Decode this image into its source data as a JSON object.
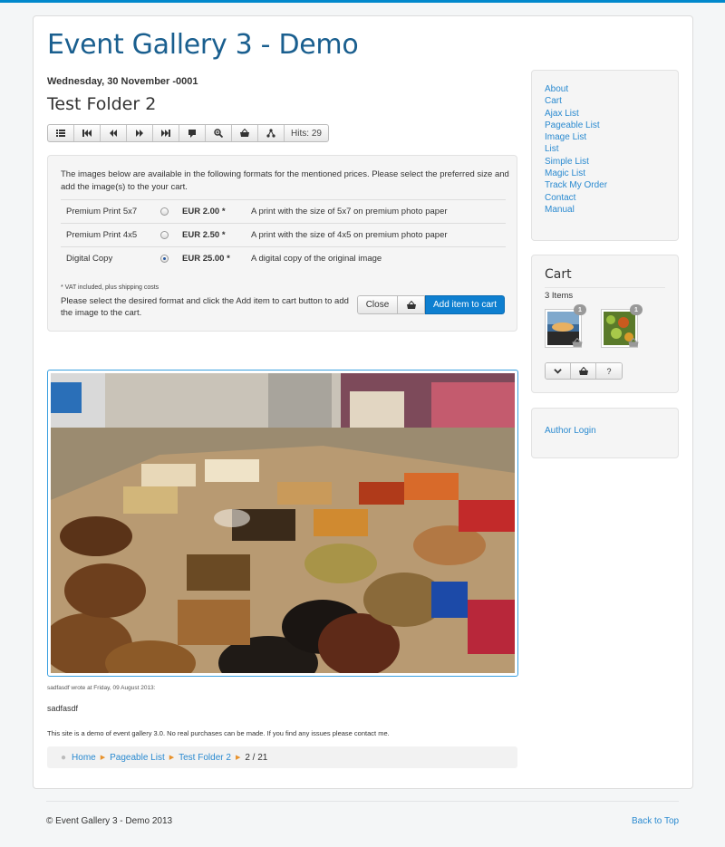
{
  "site": {
    "title": "Event Gallery 3 - Demo"
  },
  "event": {
    "date": "Wednesday, 30 November -0001",
    "folder_title": "Test Folder 2"
  },
  "toolbar": {
    "hits": "Hits: 29"
  },
  "formats": {
    "intro": "The images below are available in the following formats for the mentioned prices. Please select the preferred size and add the image(s) to the your cart.",
    "rows": [
      {
        "name": "Premium Print 5x7",
        "price": "EUR 2.00 *",
        "description": "A print with the size of 5x7 on premium photo paper",
        "selected": false
      },
      {
        "name": "Premium Print 4x5",
        "price": "EUR 2.50 *",
        "description": "A print with the size of 4x5 on premium photo paper",
        "selected": false
      },
      {
        "name": "Digital Copy",
        "price": "EUR 25.00 *",
        "description": "A digital copy of the original image",
        "selected": true
      }
    ],
    "vat_note": "* VAT included, plus shipping costs",
    "select_note": "Please select the desired format and click the Add item to cart button to add the image to the cart.",
    "close_label": "Close",
    "add_label": "Add item to cart"
  },
  "comment": {
    "meta": "sadfasdf wrote at Friday, 09 August 2013:",
    "text": "sadfasdf"
  },
  "demo_note": "This site is a demo of event gallery 3.0. No real purchases can be made. If you find any issues please contact me.",
  "breadcrumb": {
    "items": [
      "Home",
      "Pageable List",
      "Test Folder 2"
    ],
    "position": "2 / 21"
  },
  "sidebar": {
    "menu": [
      "About",
      "Cart",
      "Ajax List",
      "Pageable List",
      "Image List",
      "List",
      "Simple List",
      "Magic List",
      "Track My Order",
      "Contact",
      "Manual"
    ],
    "cart": {
      "title": "Cart",
      "count": "3 Items",
      "item_qty_1": "1",
      "item_qty_2": "1",
      "help_label": "?"
    },
    "login": "Author Login"
  },
  "footer": {
    "copyright": "© Event Gallery 3 - Demo 2013",
    "back_to_top": "Back to Top"
  },
  "colors": {
    "accent": "#0088cc",
    "title": "#1a5f8f",
    "link": "#2a8ad0",
    "button_primary": "#0e7fd0"
  }
}
